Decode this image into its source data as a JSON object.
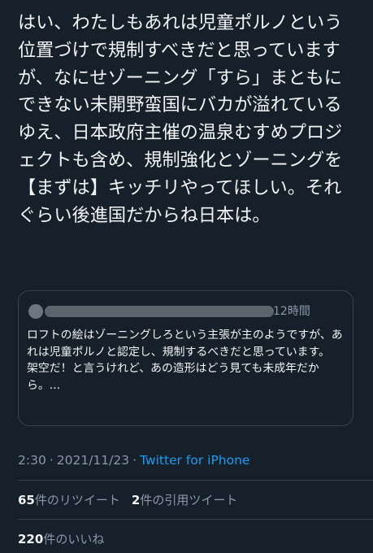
{
  "tweet": {
    "text": "はい、わたしもあれは児童ポルノという位置づけで規制すべきだと思っていますが、なにせゾーニング「すら」まともにできない未開野蛮国にバカが溢れているゆえ、日本政府主催の温泉むすめプロジェクトも含め、規制強化とゾーニングを【まずは】キッチリやってほしい。それぐらい後進国だからね日本は。"
  },
  "quote": {
    "time": "12時間",
    "text": "ロフトの絵はゾーニングしろという主張が主のようですが、あれは児童ポルノと認定し、規制するべきだと思っています。\n架空だ！と言うけれど、あの造形はどう見ても未成年だから。..."
  },
  "meta": {
    "time": "2:30",
    "separator": "·",
    "date": "2021/11/23",
    "source": "Twitter for iPhone"
  },
  "stats": {
    "retweets_count": "65",
    "retweets_label": "件のリツイート",
    "quotes_count": "2",
    "quotes_label": "件の引用ツイート",
    "likes_count": "220",
    "likes_label": "件のいいね"
  },
  "colors": {
    "background": "#15202b",
    "text": "#f2f4f5",
    "muted": "#8b98a5",
    "link": "#1d9bf0",
    "border": "#38444d"
  }
}
